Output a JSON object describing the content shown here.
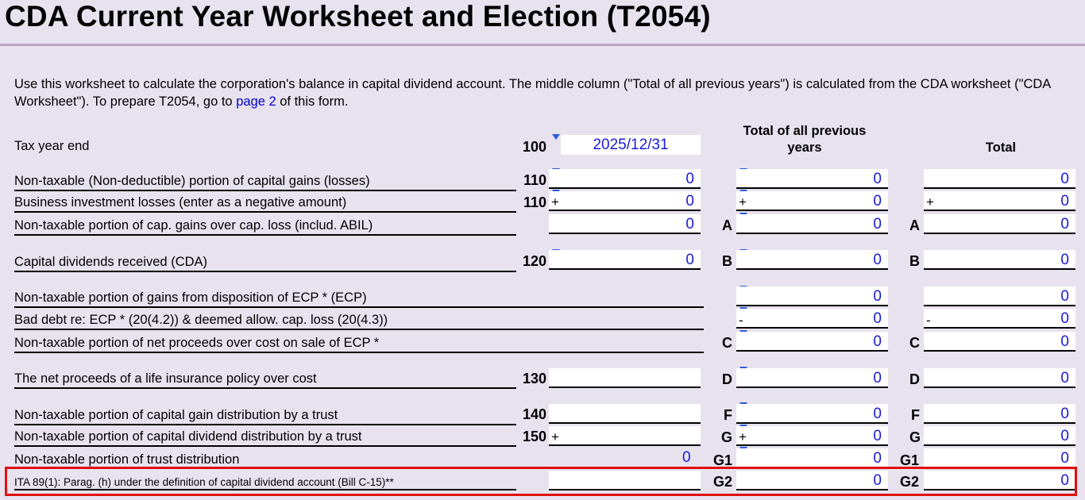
{
  "title": "CDA Current Year Worksheet and Election (T2054)",
  "intro": {
    "text_before": "Use this worksheet to calculate the corporation's balance in capital dividend account. The middle column (\"Total of all previous years\") is calculated from the CDA worksheet (\"CDA Worksheet\"). To prepare T2054, go to ",
    "link": "page 2",
    "text_after": " of this form."
  },
  "columns": {
    "previous_years": "Total of all previous years",
    "total": "Total"
  },
  "tax_year_end": {
    "label": "Tax year end",
    "code": "100",
    "value": "2025/12/31"
  },
  "rows": {
    "r1": {
      "label": "Non-taxable (Non-deductible) portion of capital gains (losses)",
      "code": "110",
      "current": "0",
      "previous": "0",
      "total": "0"
    },
    "r2": {
      "label": "Business investment losses (enter as a negative amount)",
      "code": "110",
      "sign": "+",
      "current": "0",
      "previous": "0",
      "total": "0"
    },
    "r3": {
      "label": "Non-taxable portion of cap. gains over cap. loss (includ. ABIL)",
      "letter": "A",
      "current": "0",
      "previous": "0",
      "total": "0"
    },
    "r4": {
      "label": "Capital dividends received (CDA)",
      "code": "120",
      "letter": "B",
      "current": "0",
      "previous": "0",
      "total": "0"
    },
    "r5": {
      "label": "Non-taxable portion of gains from disposition of ECP * (ECP)",
      "previous": "0",
      "total": "0"
    },
    "r6": {
      "label": "Bad debt re: ECP * (20(4.2)) & deemed allow. cap. loss (20(4.3))",
      "sign": "-",
      "previous": "0",
      "total": "0"
    },
    "r7": {
      "label": "Non-taxable portion of net proceeds over cost on sale of ECP *",
      "letter": "C",
      "previous": "0",
      "total": "0"
    },
    "r8": {
      "label": "The net proceeds of a life insurance policy over cost",
      "code": "130",
      "letter": "D",
      "previous": "0",
      "total": "0"
    },
    "r9": {
      "label": "Non-taxable portion of capital gain distribution by a trust",
      "code": "140",
      "letter": "F",
      "previous": "0",
      "total": "0"
    },
    "r10": {
      "label": "Non-taxable portion of capital dividend distribution by a trust",
      "code": "150",
      "letter": "G",
      "sign": "+",
      "previous": "0",
      "total": "0"
    },
    "r11": {
      "label": "Non-taxable portion of trust distribution",
      "letter": "G1",
      "current": "0",
      "previous": "0",
      "total": "0"
    },
    "r12": {
      "label": "ITA 89(1): Parag. (h) under the definition of capital dividend account (Bill C-15)**",
      "letter": "G2",
      "previous": "0",
      "total": "0"
    }
  }
}
